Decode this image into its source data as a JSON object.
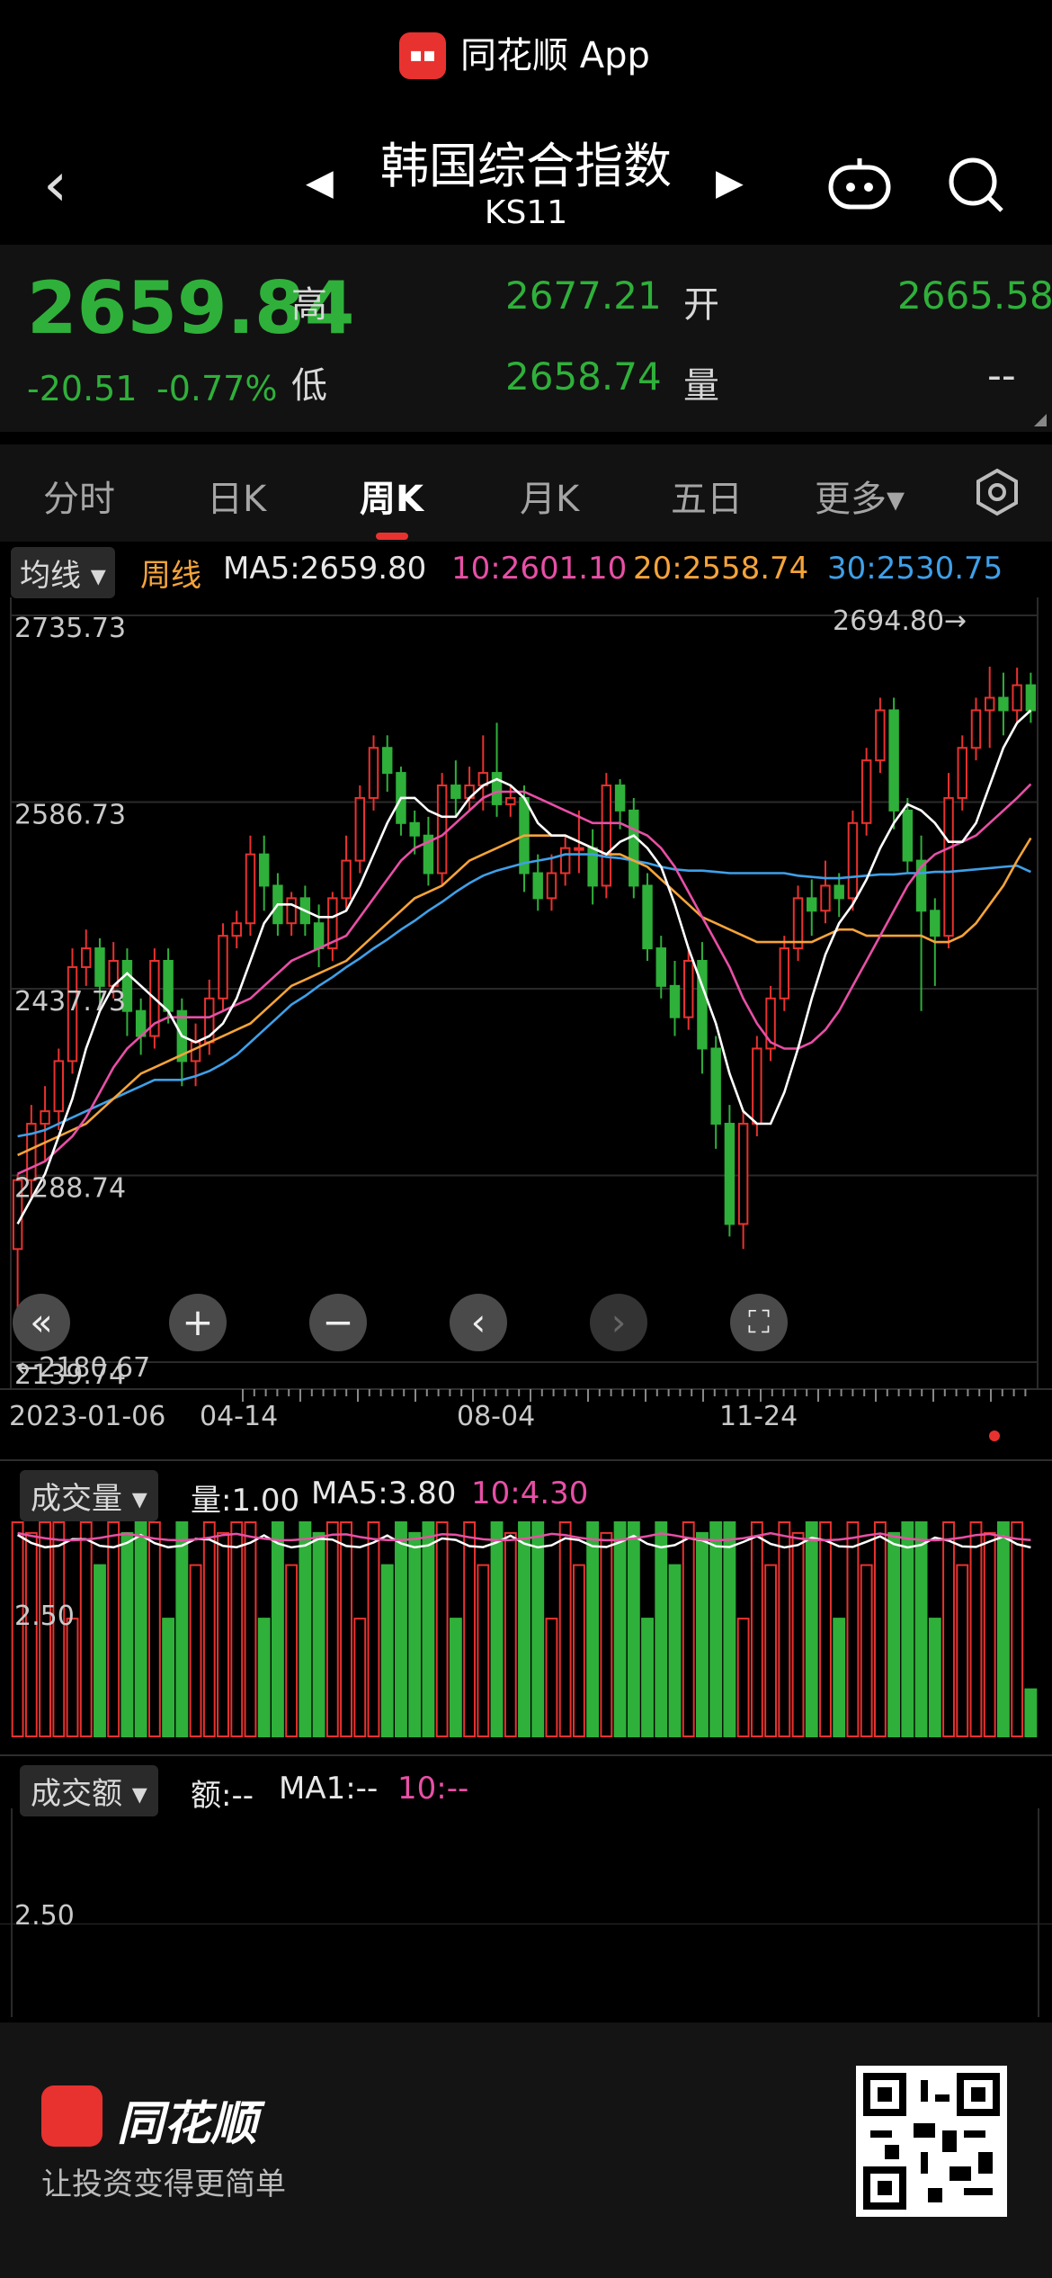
{
  "banner": {
    "app_name": "同花顺 App"
  },
  "header": {
    "title": "韩国综合指数",
    "code": "KS11"
  },
  "quote": {
    "price": "2659.84",
    "change": "-20.51",
    "change_pct": "-0.77%",
    "high_label": "高",
    "high": "2677.21",
    "open_label": "开",
    "open": "2665.58",
    "low_label": "低",
    "low": "2658.74",
    "vol_label": "量",
    "vol": "--"
  },
  "tabs": [
    {
      "label": "分时"
    },
    {
      "label": "日K"
    },
    {
      "label": "周K"
    },
    {
      "label": "月K"
    },
    {
      "label": "五日"
    },
    {
      "label": "更多▾"
    }
  ],
  "active_tab": "周K",
  "ma": {
    "selector": "均线",
    "period": "周线",
    "ma5": "MA5:2659.80",
    "ma10": "10:2601.10",
    "ma20": "20:2558.74",
    "ma30": "30:2530.75"
  },
  "colors": {
    "up": "#e8322f",
    "down": "#2fb03a",
    "ma5": "#ffffff",
    "ma10": "#e84fa6",
    "ma20": "#f5a43a",
    "ma30": "#3fa0e8"
  },
  "chart_data": {
    "type": "candlestick",
    "y_ticks": [
      "2735.73",
      "2586.73",
      "2437.73",
      "2288.74",
      "2139.74"
    ],
    "x_ticks": [
      "2023-01-06",
      "04-14",
      "08-04",
      "11-24"
    ],
    "max_label": "2694.80→",
    "min_label": "←2180.67",
    "ylim": [
      2139.74,
      2735.73
    ],
    "candles": [
      [
        2230,
        2285,
        2160,
        2290
      ],
      [
        2285,
        2330,
        2270,
        2345
      ],
      [
        2330,
        2340,
        2300,
        2360
      ],
      [
        2340,
        2380,
        2325,
        2390
      ],
      [
        2380,
        2455,
        2370,
        2470
      ],
      [
        2455,
        2470,
        2440,
        2485
      ],
      [
        2470,
        2440,
        2425,
        2478
      ],
      [
        2440,
        2460,
        2430,
        2475
      ],
      [
        2460,
        2420,
        2400,
        2470
      ],
      [
        2420,
        2400,
        2385,
        2430
      ],
      [
        2400,
        2460,
        2390,
        2470
      ],
      [
        2460,
        2420,
        2410,
        2470
      ],
      [
        2420,
        2380,
        2360,
        2430
      ],
      [
        2380,
        2395,
        2360,
        2410
      ],
      [
        2395,
        2430,
        2385,
        2445
      ],
      [
        2430,
        2480,
        2420,
        2490
      ],
      [
        2480,
        2490,
        2470,
        2500
      ],
      [
        2490,
        2545,
        2480,
        2560
      ],
      [
        2545,
        2520,
        2500,
        2560
      ],
      [
        2520,
        2490,
        2480,
        2530
      ],
      [
        2490,
        2510,
        2480,
        2515
      ],
      [
        2510,
        2490,
        2480,
        2520
      ],
      [
        2490,
        2470,
        2455,
        2505
      ],
      [
        2470,
        2510,
        2460,
        2515
      ],
      [
        2510,
        2540,
        2500,
        2560
      ],
      [
        2540,
        2590,
        2530,
        2600
      ],
      [
        2590,
        2630,
        2580,
        2640
      ],
      [
        2630,
        2610,
        2595,
        2640
      ],
      [
        2610,
        2570,
        2560,
        2615
      ],
      [
        2570,
        2560,
        2545,
        2580
      ],
      [
        2560,
        2530,
        2520,
        2575
      ],
      [
        2530,
        2600,
        2520,
        2610
      ],
      [
        2600,
        2590,
        2575,
        2620
      ],
      [
        2590,
        2600,
        2580,
        2615
      ],
      [
        2600,
        2610,
        2580,
        2640
      ],
      [
        2610,
        2585,
        2575,
        2650
      ],
      [
        2585,
        2590,
        2575,
        2600
      ],
      [
        2590,
        2530,
        2515,
        2600
      ],
      [
        2530,
        2510,
        2500,
        2545
      ],
      [
        2510,
        2530,
        2500,
        2545
      ],
      [
        2530,
        2550,
        2520,
        2560
      ],
      [
        2550,
        2550,
        2530,
        2580
      ],
      [
        2550,
        2520,
        2505,
        2565
      ],
      [
        2520,
        2600,
        2510,
        2610
      ],
      [
        2600,
        2580,
        2565,
        2605
      ],
      [
        2580,
        2520,
        2510,
        2590
      ],
      [
        2520,
        2470,
        2460,
        2530
      ],
      [
        2470,
        2440,
        2430,
        2480
      ],
      [
        2440,
        2415,
        2400,
        2460
      ],
      [
        2415,
        2460,
        2405,
        2470
      ],
      [
        2460,
        2390,
        2370,
        2475
      ],
      [
        2390,
        2330,
        2310,
        2400
      ],
      [
        2330,
        2250,
        2240,
        2345
      ],
      [
        2250,
        2330,
        2230,
        2340
      ],
      [
        2330,
        2390,
        2320,
        2400
      ],
      [
        2390,
        2430,
        2380,
        2440
      ],
      [
        2430,
        2470,
        2420,
        2480
      ],
      [
        2470,
        2510,
        2460,
        2520
      ],
      [
        2510,
        2500,
        2480,
        2525
      ],
      [
        2500,
        2520,
        2490,
        2540
      ],
      [
        2520,
        2510,
        2495,
        2530
      ],
      [
        2510,
        2570,
        2500,
        2580
      ],
      [
        2570,
        2620,
        2560,
        2630
      ],
      [
        2620,
        2660,
        2610,
        2670
      ],
      [
        2660,
        2580,
        2565,
        2670
      ],
      [
        2580,
        2540,
        2530,
        2590
      ],
      [
        2540,
        2500,
        2420,
        2560
      ],
      [
        2500,
        2480,
        2440,
        2510
      ],
      [
        2480,
        2590,
        2470,
        2610
      ],
      [
        2590,
        2630,
        2580,
        2640
      ],
      [
        2630,
        2660,
        2620,
        2670
      ],
      [
        2660,
        2670,
        2630,
        2694.8
      ],
      [
        2670,
        2660,
        2640,
        2690
      ],
      [
        2660,
        2680,
        2650,
        2694
      ],
      [
        2680,
        2660,
        2650,
        2690
      ]
    ],
    "ma5": [
      2250,
      2270,
      2290,
      2320,
      2350,
      2390,
      2420,
      2440,
      2450,
      2440,
      2430,
      2420,
      2400,
      2395,
      2400,
      2410,
      2430,
      2460,
      2490,
      2505,
      2505,
      2500,
      2495,
      2495,
      2500,
      2520,
      2545,
      2570,
      2590,
      2590,
      2580,
      2575,
      2575,
      2590,
      2600,
      2605,
      2600,
      2590,
      2570,
      2560,
      2560,
      2555,
      2550,
      2545,
      2555,
      2560,
      2550,
      2535,
      2505,
      2470,
      2440,
      2410,
      2370,
      2340,
      2330,
      2330,
      2355,
      2390,
      2430,
      2465,
      2490,
      2505,
      2525,
      2550,
      2570,
      2585,
      2580,
      2570,
      2555,
      2555,
      2570,
      2600,
      2630,
      2650,
      2660
    ],
    "ma10": [
      2290,
      2295,
      2300,
      2310,
      2320,
      2335,
      2355,
      2375,
      2390,
      2400,
      2410,
      2415,
      2415,
      2415,
      2415,
      2420,
      2425,
      2430,
      2440,
      2450,
      2460,
      2465,
      2470,
      2475,
      2480,
      2495,
      2510,
      2525,
      2540,
      2550,
      2555,
      2560,
      2570,
      2580,
      2590,
      2595,
      2595,
      2595,
      2590,
      2585,
      2580,
      2575,
      2570,
      2570,
      2570,
      2565,
      2560,
      2550,
      2535,
      2515,
      2495,
      2475,
      2455,
      2430,
      2410,
      2395,
      2390,
      2390,
      2395,
      2405,
      2420,
      2440,
      2460,
      2480,
      2500,
      2520,
      2535,
      2545,
      2550,
      2555,
      2560,
      2570,
      2580,
      2590,
      2601
    ],
    "ma20": [
      2305,
      2310,
      2315,
      2320,
      2325,
      2330,
      2340,
      2350,
      2360,
      2370,
      2375,
      2380,
      2385,
      2390,
      2395,
      2400,
      2405,
      2410,
      2420,
      2430,
      2440,
      2445,
      2450,
      2455,
      2460,
      2470,
      2480,
      2490,
      2500,
      2510,
      2515,
      2520,
      2530,
      2540,
      2545,
      2550,
      2555,
      2560,
      2560,
      2560,
      2560,
      2555,
      2550,
      2545,
      2545,
      2540,
      2535,
      2525,
      2515,
      2505,
      2495,
      2490,
      2485,
      2480,
      2475,
      2475,
      2475,
      2475,
      2475,
      2480,
      2485,
      2485,
      2480,
      2480,
      2480,
      2480,
      2480,
      2475,
      2475,
      2480,
      2490,
      2505,
      2520,
      2540,
      2558
    ],
    "ma30": [
      2320,
      2322,
      2325,
      2330,
      2335,
      2340,
      2345,
      2350,
      2355,
      2360,
      2365,
      2365,
      2365,
      2368,
      2372,
      2378,
      2385,
      2395,
      2405,
      2415,
      2425,
      2432,
      2440,
      2447,
      2455,
      2462,
      2470,
      2477,
      2485,
      2492,
      2500,
      2507,
      2515,
      2522,
      2528,
      2532,
      2535,
      2538,
      2540,
      2542,
      2545,
      2545,
      2545,
      2543,
      2542,
      2540,
      2538,
      2535,
      2533,
      2532,
      2532,
      2531,
      2530,
      2530,
      2530,
      2530,
      2530,
      2528,
      2527,
      2526,
      2526,
      2527,
      2528,
      2529,
      2529,
      2530,
      2530,
      2531,
      2531,
      2532,
      2533,
      2534,
      2535,
      2536,
      2531
    ]
  },
  "controls": [
    "«",
    "+",
    "−",
    "‹",
    "›",
    "⛶"
  ],
  "volume": {
    "selector": "成交量",
    "vol": "量:1.00",
    "ma5": "MA5:3.80",
    "ma10": "10:4.30",
    "y_tick": "2.50"
  },
  "amount": {
    "selector": "成交额",
    "amt": "额:--",
    "ma1": "MA1:--",
    "ma10": "10:--",
    "y_tick": "2.50"
  },
  "footer": {
    "name": "同花顺",
    "slogan": "让投资变得更简单"
  }
}
